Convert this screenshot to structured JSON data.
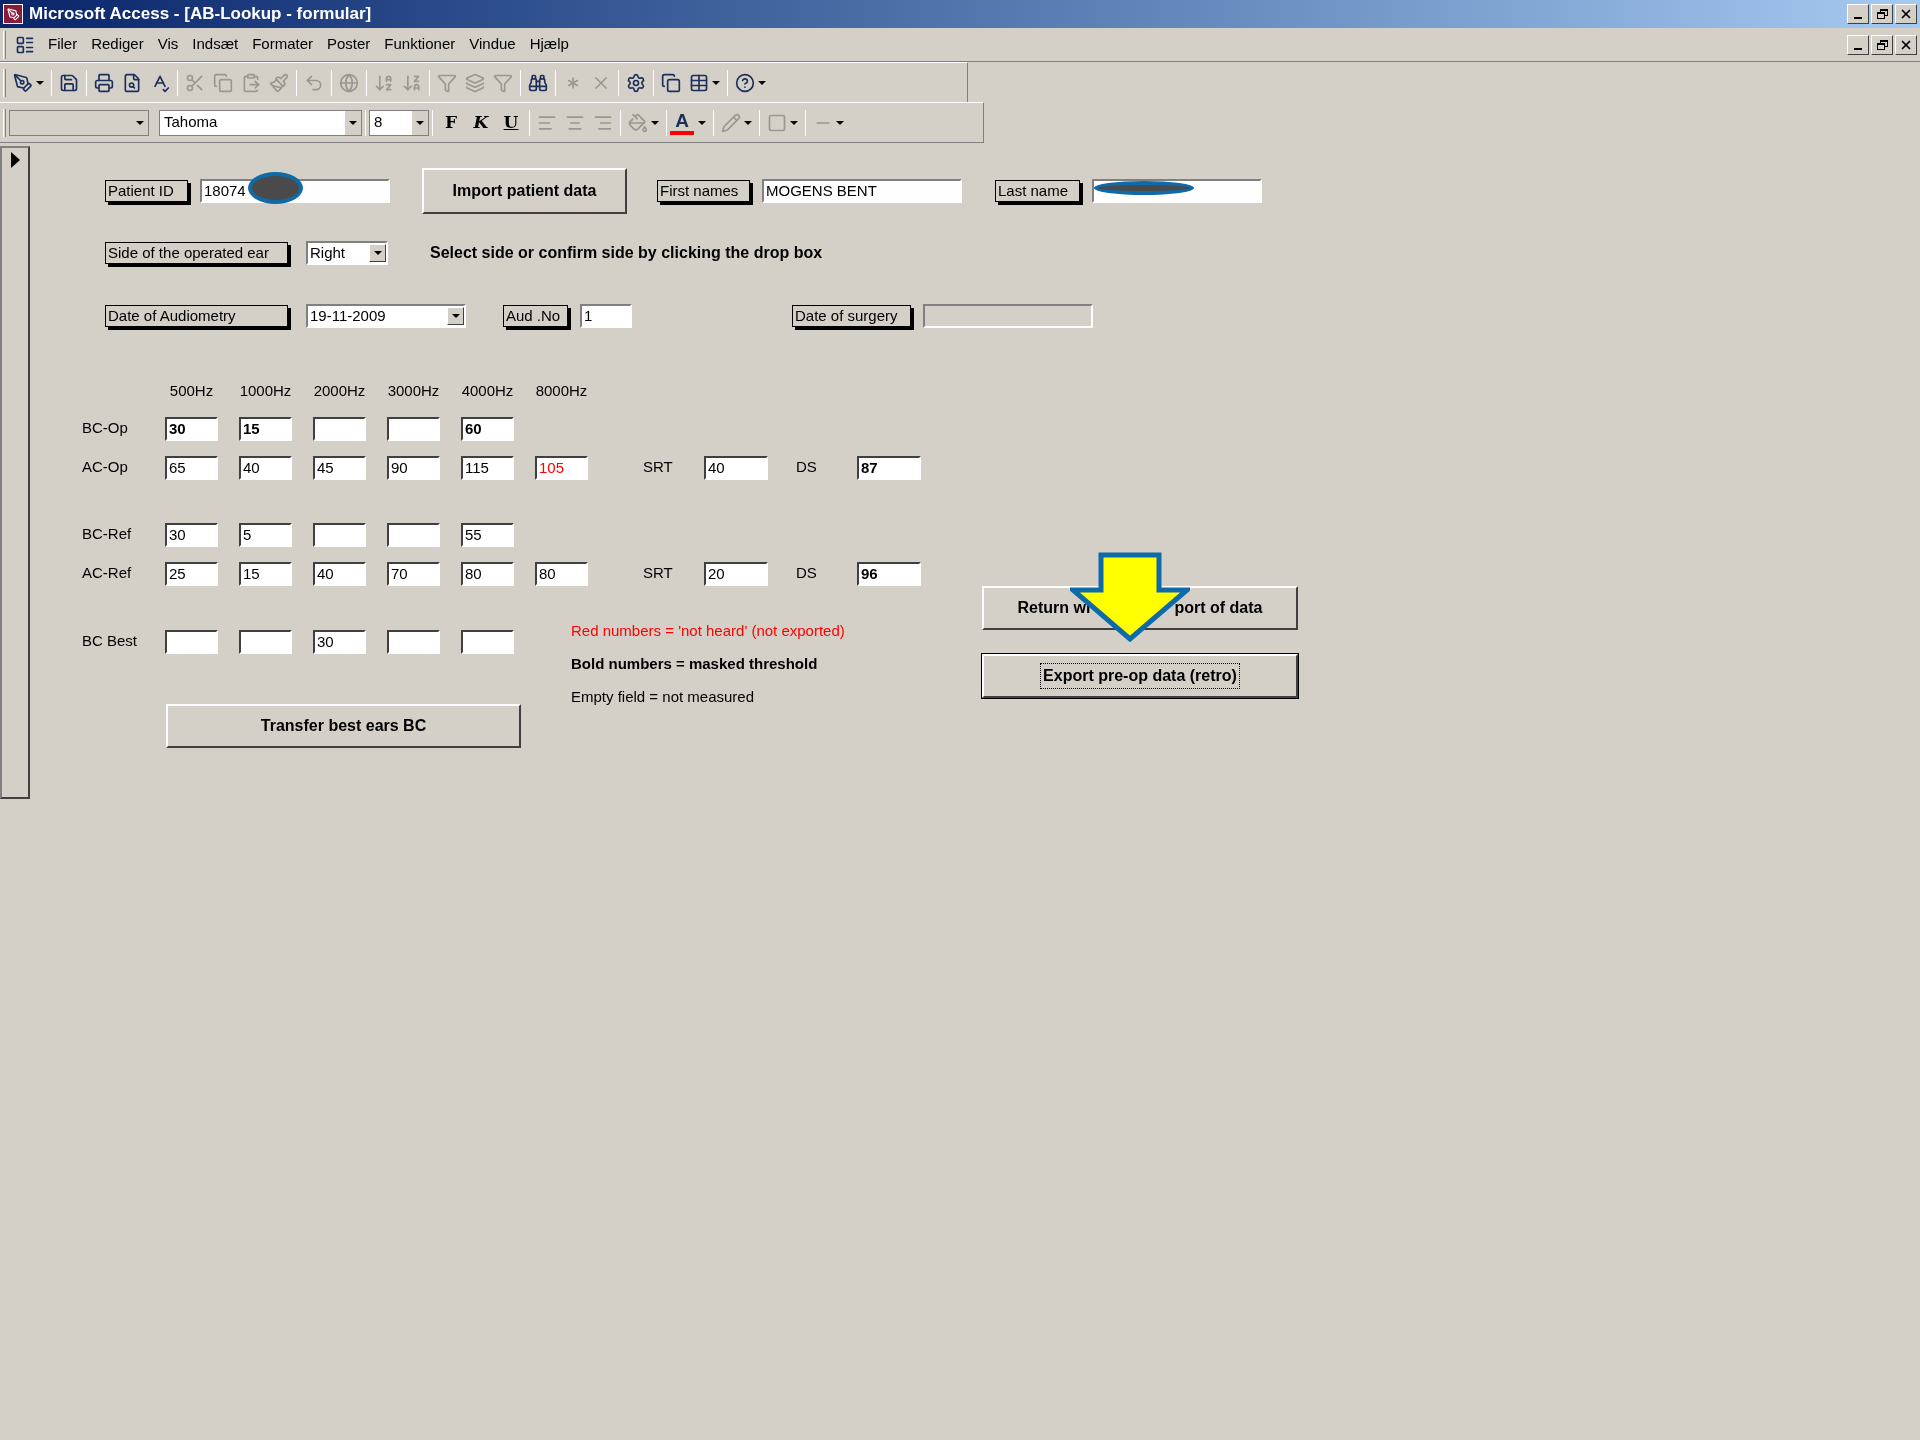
{
  "title_bar": {
    "title": "Microsoft Access - [AB-Lookup - formular]"
  },
  "menu_bar": [
    "Filer",
    "Rediger",
    "Vis",
    "Indsæt",
    "Formater",
    "Poster",
    "Funktioner",
    "Vindue",
    "Hjælp"
  ],
  "format_toolbar": {
    "font": "Tahoma",
    "size": "8",
    "bold_button": "F",
    "italic_button": "K",
    "underline_button": "U",
    "font_color_button": "A"
  },
  "form": {
    "patient_id": {
      "label": "Patient ID",
      "value": "18074",
      "redacted": true
    },
    "import_button": "Import patient data",
    "first_names": {
      "label": "First names",
      "value": "MOGENS BENT"
    },
    "last_name": {
      "label": "Last name",
      "redacted": true
    },
    "side": {
      "label": "Side of the operated ear",
      "value": "Right"
    },
    "side_hint": "Select side or confirm side by clicking the drop box",
    "audiometry_date": {
      "label": "Date of Audiometry",
      "value": "19-11-2009"
    },
    "aud_no": {
      "label": "Aud .No",
      "value": "1"
    },
    "surgery_date": {
      "label": "Date of surgery",
      "disabled": true
    },
    "frequencies": [
      "500Hz",
      "1000Hz",
      "2000Hz",
      "3000Hz",
      "4000Hz",
      "8000Hz"
    ],
    "rows": [
      {
        "label": "BC-Op",
        "cells": [
          {
            "value": "30",
            "masked": true,
            "not_heard": false
          },
          {
            "value": "15",
            "masked": true,
            "not_heard": false
          },
          {},
          {},
          {
            "value": "60",
            "masked": true,
            "not_heard": false
          }
        ]
      },
      {
        "label": "AC-Op",
        "cells": [
          {
            "value": "65",
            "masked": false,
            "not_heard": false
          },
          {
            "value": "40",
            "masked": false,
            "not_heard": false
          },
          {
            "value": "45",
            "masked": false,
            "not_heard": false
          },
          {
            "value": "90",
            "masked": false,
            "not_heard": false
          },
          {
            "value": "115",
            "masked": false,
            "not_heard": false
          },
          {
            "value": "105",
            "masked": false,
            "not_heard": true
          }
        ],
        "srt": {
          "label": "SRT",
          "value": "40"
        },
        "ds": {
          "label": "DS",
          "value": "87",
          "masked": true
        }
      },
      {
        "label": "BC-Ref",
        "cells": [
          {
            "value": "30",
            "masked": false,
            "not_heard": false
          },
          {
            "value": "5",
            "masked": false,
            "not_heard": false
          },
          {},
          {},
          {
            "value": "55",
            "masked": false,
            "not_heard": false
          }
        ]
      },
      {
        "label": "AC-Ref",
        "cells": [
          {
            "value": "25",
            "masked": false,
            "not_heard": false
          },
          {
            "value": "15",
            "masked": false,
            "not_heard": false
          },
          {
            "value": "40",
            "masked": false,
            "not_heard": false
          },
          {
            "value": "70",
            "masked": false,
            "not_heard": false
          },
          {
            "value": "80",
            "masked": false,
            "not_heard": false
          },
          {
            "value": "80",
            "masked": false,
            "not_heard": false
          }
        ],
        "srt": {
          "label": "SRT",
          "value": "20"
        },
        "ds": {
          "label": "DS",
          "value": "96",
          "masked": true
        }
      }
    ],
    "best_row": {
      "label": "BC Best",
      "cells": [
        {},
        {},
        {
          "value": "30",
          "masked": false,
          "not_heard": false
        },
        {},
        {}
      ]
    },
    "legend": [
      {
        "kind": "red",
        "text": "Red numbers = 'not heard' (not exported)"
      },
      {
        "kind": "bold",
        "text": "Bold numbers = masked threshold"
      },
      {
        "kind": "plain",
        "text": "Empty field = not measured"
      }
    ],
    "transfer_button": "Transfer best ears BC",
    "return_button": [
      "Return wi",
      "port of data"
    ],
    "export_button": {
      "label": "Export pre-op data (retro)",
      "focused": true
    }
  }
}
